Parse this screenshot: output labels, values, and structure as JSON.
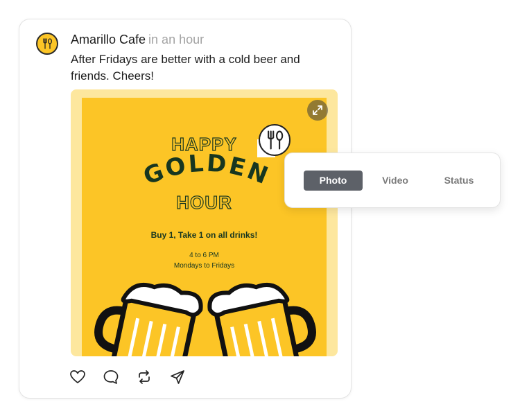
{
  "post": {
    "author": "Amarillo Cafe",
    "time": "in an hour",
    "caption": "After Fridays are better with a cold beer and friends. Cheers!",
    "avatar_icon": "fork-spoon-icon"
  },
  "poster": {
    "line1": "HAPPY",
    "line2": "GOLDEN",
    "line3": "HOUR",
    "offer": "Buy 1, Take 1 on all drinks!",
    "time": "4 to 6 PM",
    "days": "Mondays to Fridays"
  },
  "actions": [
    "heart-icon",
    "comment-icon",
    "repost-icon",
    "send-icon"
  ],
  "tabs": [
    {
      "label": "Photo",
      "active": true
    },
    {
      "label": "Video",
      "active": false
    },
    {
      "label": "Status",
      "active": false
    }
  ],
  "colors": {
    "poster_bg": "#fcc526",
    "media_frame": "#fde79e",
    "text_dark_green": "#173620",
    "active_tab": "#5d6168"
  }
}
